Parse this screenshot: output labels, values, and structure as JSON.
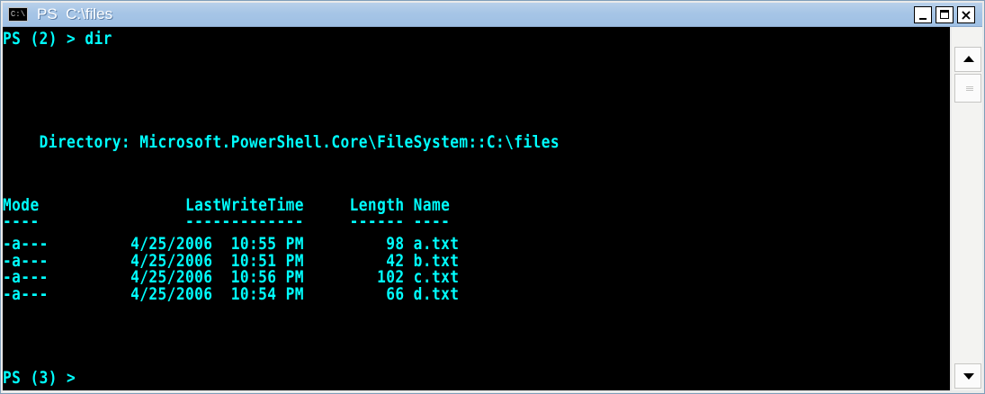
{
  "window": {
    "title": "PS  C:\\files",
    "icon": "C:\\",
    "app_icon_name": "console-icon"
  },
  "colors": {
    "console_bg": "#000000",
    "console_text": "#00ffff",
    "titlebar": "#a6c5e6"
  },
  "console": {
    "prompt1": "PS (2) > dir",
    "directory_line": "    Directory: Microsoft.PowerShell.Core\\FileSystem::C:\\files",
    "header": "Mode                LastWriteTime     Length Name",
    "separator": "----                -------------     ------ ----",
    "rows": [
      "-a---         4/25/2006  10:55 PM         98 a.txt",
      "-a---         4/25/2006  10:51 PM         42 b.txt",
      "-a---         4/25/2006  10:56 PM        102 c.txt",
      "-a---         4/25/2006  10:54 PM         66 d.txt"
    ],
    "prompt2": "PS (3) >"
  }
}
